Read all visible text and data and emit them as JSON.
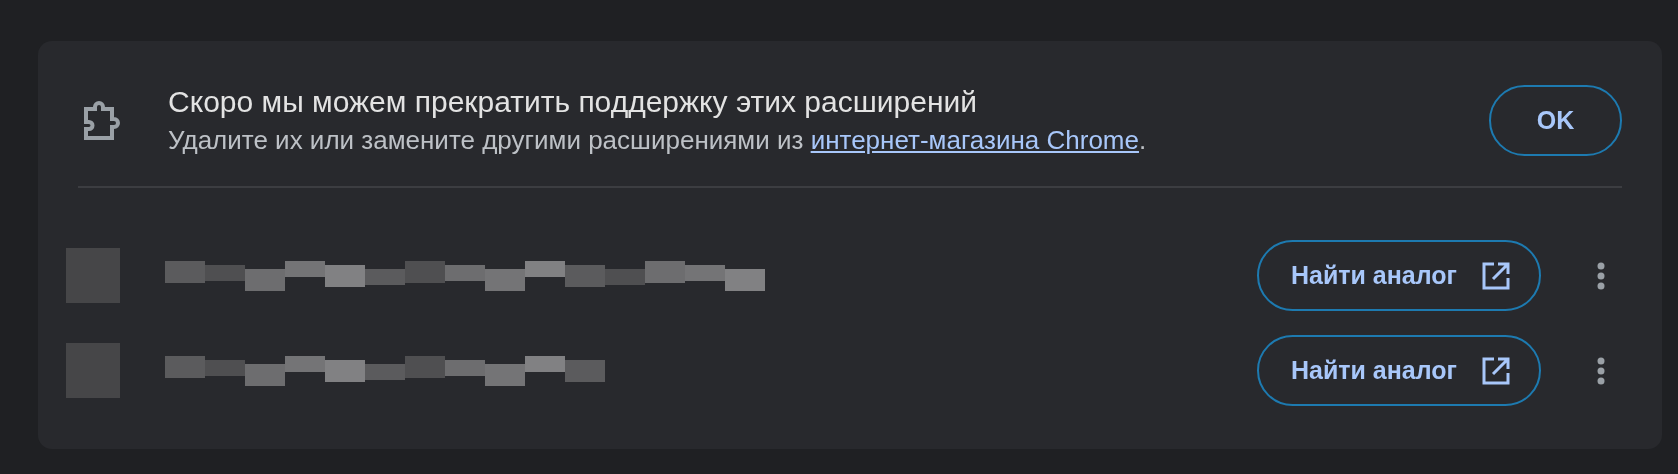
{
  "notice": {
    "title": "Скоро мы можем прекратить поддержку этих расширений",
    "text_before": "Удалите их или замените другими расширениями из ",
    "link": "интернет-магазина Chrome",
    "text_after": ".",
    "ok_button": "OK"
  },
  "extensions": [
    {
      "action": "Найти аналог"
    },
    {
      "action": "Найти аналог"
    }
  ]
}
